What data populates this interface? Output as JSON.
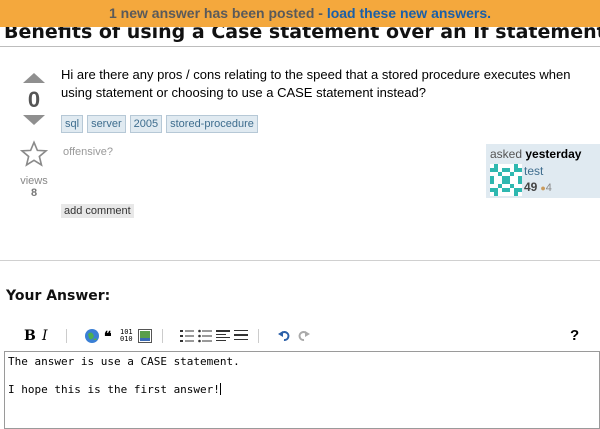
{
  "notification": {
    "text": "1 new answer has been posted - ",
    "link": "load these new answers."
  },
  "question": {
    "title": "Benefits of using a Case statement over an If statement in a s",
    "body": "Hi are there any pros / cons relating to the speed that a stored procedure executes when using statement or choosing to use a CASE statement instead?",
    "votes": "0",
    "views_label": "views",
    "views_count": "8",
    "tags": [
      "sql",
      "server",
      "2005",
      "stored-procedure"
    ],
    "offensive_label": "offensive?",
    "add_comment_label": "add comment"
  },
  "asked": {
    "prefix": "asked",
    "when": "yesterday",
    "user": "test",
    "reputation": "49",
    "bronze_badges": "4"
  },
  "answer": {
    "heading": "Your Answer:",
    "help_label": "?",
    "line1": "The answer is use a CASE statement.",
    "line2": "",
    "line3": "I hope this is the first answer!"
  },
  "colors": {
    "notify_bg": "#f4a83d",
    "link": "#1a5fa8",
    "tag_bg": "#e0eaf1",
    "tag_text": "#3e6d8e"
  },
  "icons": [
    "vote-up-icon",
    "vote-down-icon",
    "favorite-star-icon",
    "bold-icon",
    "italic-icon",
    "hyperlink-icon",
    "blockquote-icon",
    "code-icon",
    "image-icon",
    "numbered-list-icon",
    "bulleted-list-icon",
    "heading-icon",
    "horizontal-rule-icon",
    "undo-icon",
    "redo-icon"
  ]
}
